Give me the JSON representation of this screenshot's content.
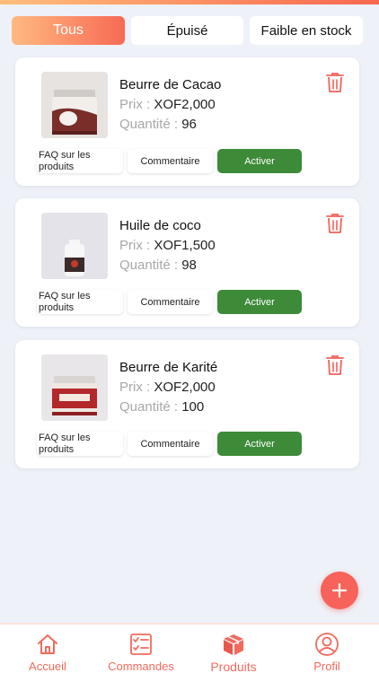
{
  "tabs": [
    {
      "label": "Tous",
      "active": true
    },
    {
      "label": "Épuisé",
      "active": false
    },
    {
      "label": "Faible en stock",
      "active": false
    }
  ],
  "labels": {
    "price": "Prix : ",
    "quantity": "Quantité : ",
    "faq": "FAQ sur les produits",
    "comment": "Commentaire",
    "activate": "Activer"
  },
  "products": [
    {
      "name": "Beurre de Cacao",
      "price": "XOF2,000",
      "quantity": "96"
    },
    {
      "name": "Huile de coco",
      "price": "XOF1,500",
      "quantity": "98"
    },
    {
      "name": "Beurre de Karité",
      "price": "XOF2,000",
      "quantity": "100"
    }
  ],
  "fab": {
    "icon": "plus-icon"
  },
  "nav": [
    {
      "label": "Accueil",
      "icon": "home-icon"
    },
    {
      "label": "Commandes",
      "icon": "clipboard-check-icon"
    },
    {
      "label": "Produits",
      "icon": "box-icon",
      "active": true
    },
    {
      "label": "Profil",
      "icon": "user-icon"
    }
  ],
  "colors": {
    "accent": "#f7674f",
    "accent_light": "#ffbe7a",
    "activate_green": "#3d8a38",
    "background": "#eef1f8"
  }
}
